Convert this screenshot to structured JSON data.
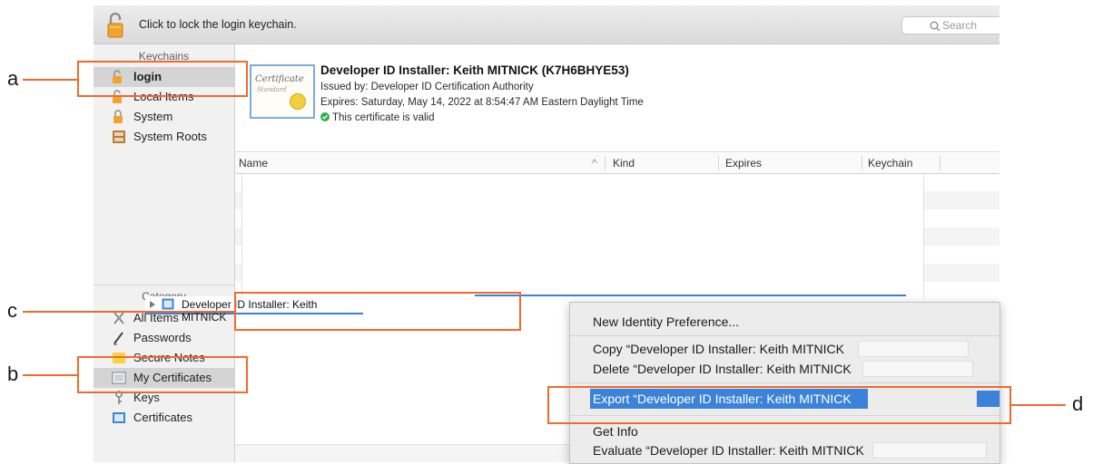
{
  "toolbar": {
    "lock_text": "Click to lock the login keychain.",
    "search_placeholder": "Search"
  },
  "sidebar": {
    "keychains_header": "Keychains",
    "keychains": [
      {
        "label": "login",
        "icon": "lock-open-icon",
        "selected": true
      },
      {
        "label": "Local Items",
        "icon": "lock-open-icon"
      },
      {
        "label": "System",
        "icon": "lock-icon"
      },
      {
        "label": "System Roots",
        "icon": "cabinet-icon"
      }
    ],
    "category_header": "Category",
    "categories": [
      {
        "label": "All Items",
        "icon": "all-items-icon"
      },
      {
        "label": "Passwords",
        "icon": "pencil-icon"
      },
      {
        "label": "Secure Notes",
        "icon": "note-icon"
      },
      {
        "label": "My Certificates",
        "icon": "certificate-icon",
        "selected": true
      },
      {
        "label": "Keys",
        "icon": "key-icon"
      },
      {
        "label": "Certificates",
        "icon": "certificate-icon"
      }
    ]
  },
  "certificate": {
    "image_caption": "Certificate",
    "image_subcaption": "Standard",
    "title": "Developer ID Installer: Keith MITNICK (K7H6BHYE53)",
    "issued_by": "Issued by: Developer ID Certification Authority",
    "expires": "Expires: Saturday, May 14, 2022 at 8:54:47 AM Eastern Daylight Time",
    "status": "This certificate is valid",
    "status_color": "#2fb24a"
  },
  "table": {
    "columns": [
      "Name",
      "Kind",
      "Expires",
      "Keychain"
    ],
    "sort_indicator": "^",
    "selected_row": "Developer ID Installer: Keith MITNICK"
  },
  "context_menu": {
    "items": [
      {
        "label": "New Identity Preference...",
        "group": 1
      },
      {
        "label": "Copy “Developer ID Installer: Keith MITNICK",
        "group": 2
      },
      {
        "label": "Delete “Developer ID Installer: Keith MITNICK",
        "group": 2
      },
      {
        "label": "Export “Developer ID Installer: Keith MITNICK",
        "group": 3,
        "highlighted": true
      },
      {
        "label": "Get Info",
        "group": 4
      },
      {
        "label": "Evaluate “Developer ID Installer: Keith MITNICK",
        "group": 4
      }
    ],
    "highlight_color": "#3b82d9"
  },
  "annotations": {
    "a": "a",
    "b": "b",
    "c": "c",
    "d": "d",
    "color": "#f06a2c"
  }
}
